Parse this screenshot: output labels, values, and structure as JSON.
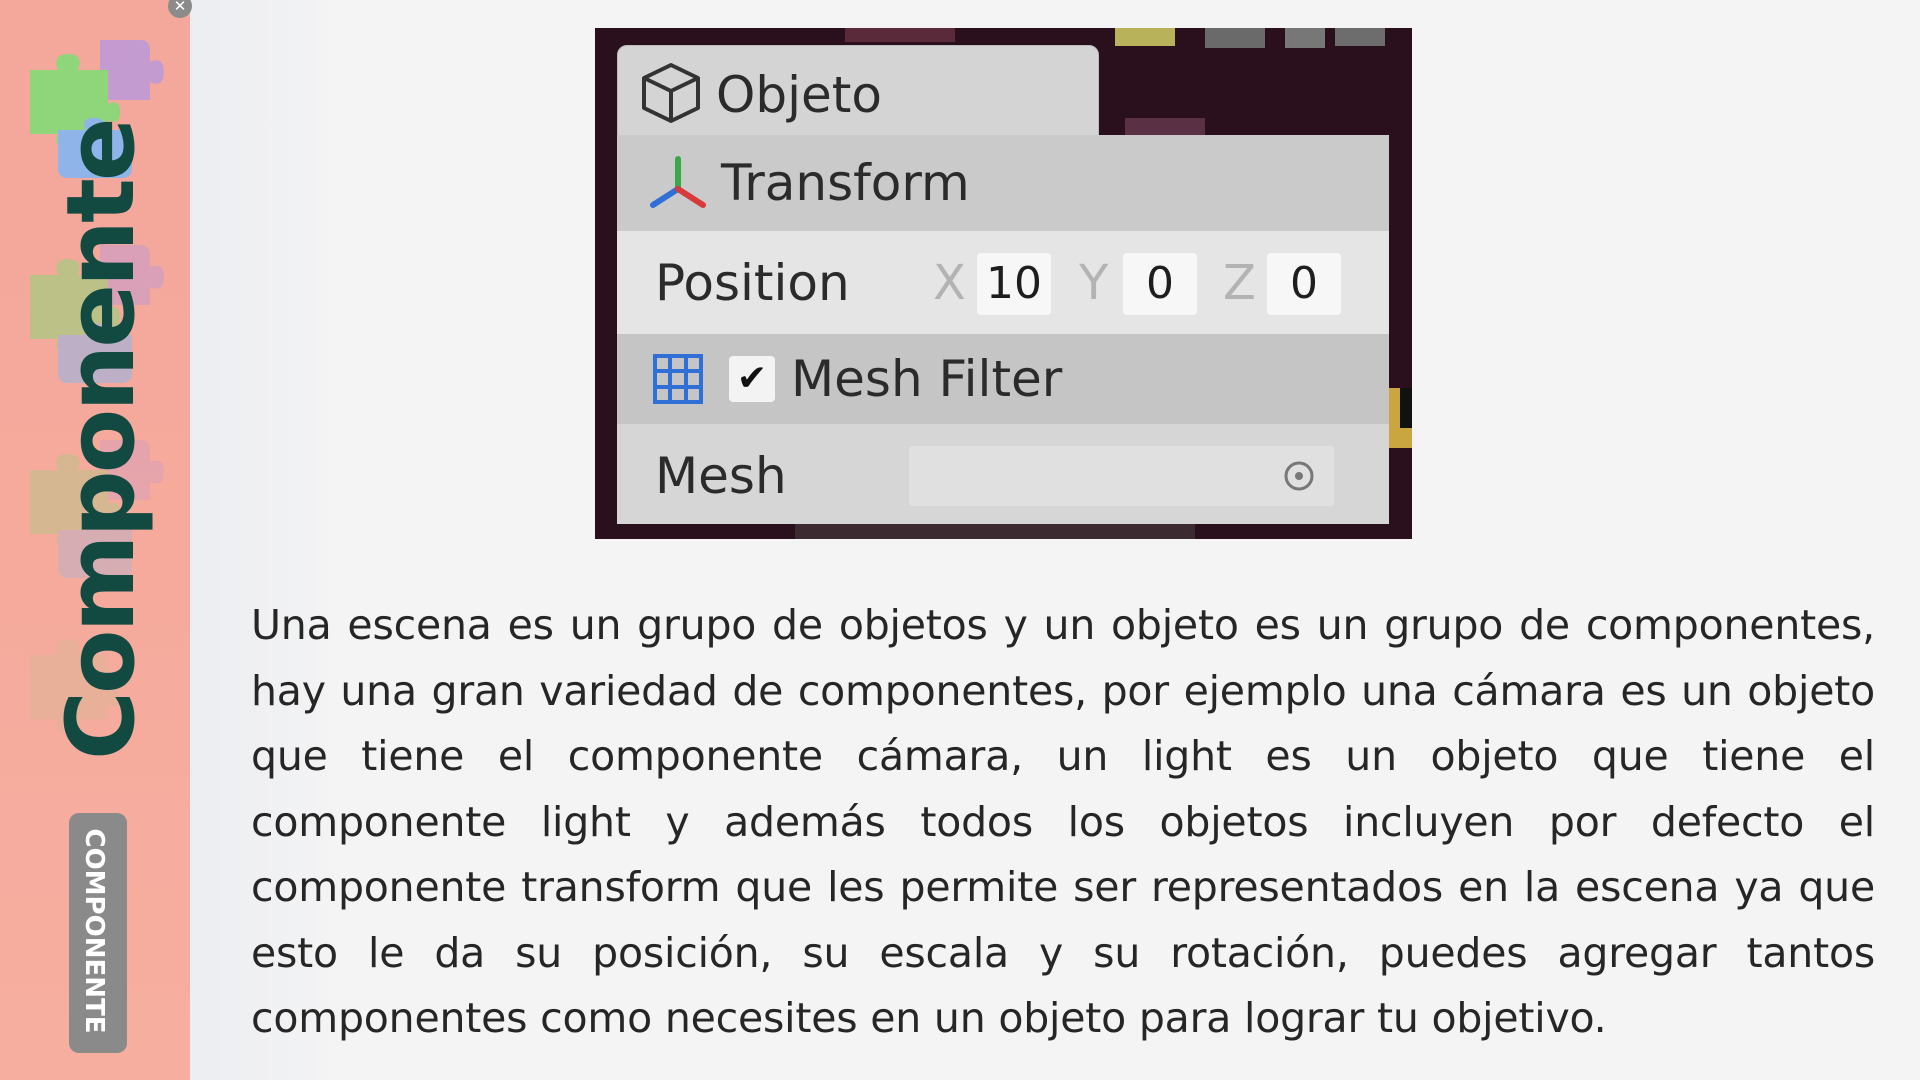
{
  "sidebar": {
    "close_glyph": "✕",
    "vertical_title": "Componente",
    "tag_label": "COMPONENTE",
    "colors": {
      "background": "#f4a79b",
      "title": "#124a42",
      "tag": "#8a8a8a"
    },
    "decoration_icon": "puzzle-pieces-icon"
  },
  "inspector": {
    "object_title": "Objeto",
    "object_icon": "cube-icon",
    "transform_label": "Transform",
    "transform_icon": "transform-axes-icon",
    "position": {
      "label": "Position",
      "x_label": "X",
      "x_value": "10",
      "y_label": "Y",
      "y_value": "0",
      "z_label": "Z",
      "z_value": "0"
    },
    "mesh_filter": {
      "icon": "grid-icon",
      "checkbox_mark": "✔",
      "enabled": true,
      "label": "Mesh Filter"
    },
    "mesh": {
      "label": "Mesh",
      "value": "",
      "picker_icon": "target-icon"
    }
  },
  "content": {
    "description": "Una escena es un grupo de objetos y un objeto es un grupo de componentes, hay una gran variedad de componentes, por ejemplo una cámara es un objeto que tiene el componente cámara, un light es un objeto que tiene el componente light y además todos los objetos incluyen por defecto el componente transform que les permite ser representados en la escena ya que esto le da su posición, su escala y su rotación, puedes agregar tantos componentes como necesites en un objeto para lograr tu objetivo."
  }
}
